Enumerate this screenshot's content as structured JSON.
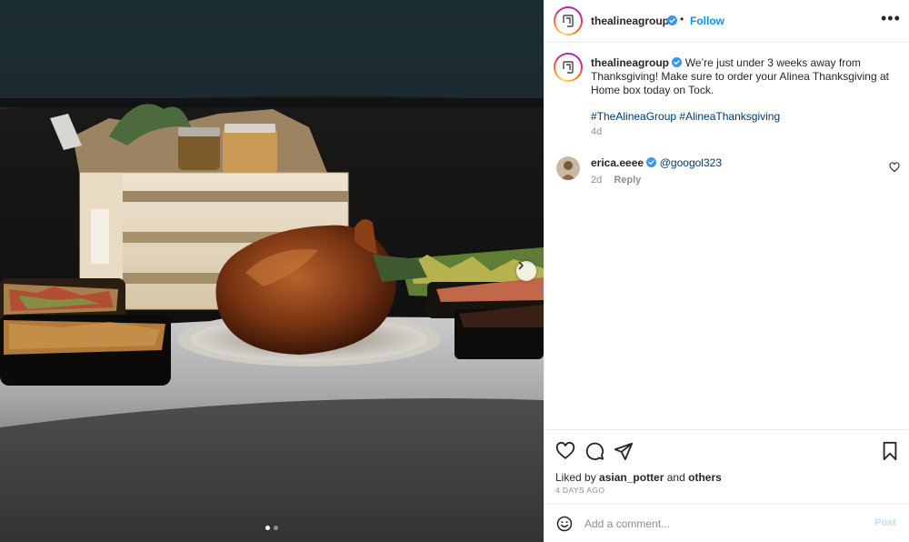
{
  "post": {
    "author": "thealineagroup",
    "follow_label": "Follow",
    "bullet": "•",
    "more_label": "•••",
    "caption_text": "We’re just under 3 weeks away from Thanksgiving! Make sure to order your Alinea Thanksgiving at Home box today on Tock.",
    "caption_tags": "#TheAlineaGroup #AlineaThanksgiving",
    "caption_age": "4d"
  },
  "comments": [
    {
      "user": "erica.eeee",
      "text": "@googol323",
      "age": "2d",
      "reply_label": "Reply"
    }
  ],
  "engagement": {
    "liked_by_prefix": "Liked by",
    "liked_by_user": "asian_potter",
    "liked_by_and": "and",
    "liked_by_others": "others",
    "date": "4 DAYS AGO"
  },
  "composer": {
    "placeholder": "Add a comment...",
    "post_label": "Post"
  },
  "carousel": {
    "slides": 2,
    "current": 1
  },
  "colors": {
    "accent": "#0095f6",
    "verified": "#3897f0",
    "link": "#00376b",
    "muted": "#8e8e8e"
  },
  "icons": [
    "more-icon",
    "verified-icon",
    "heart-icon",
    "comment-icon",
    "share-icon",
    "bookmark-icon",
    "emoji-icon",
    "chevron-right-icon"
  ]
}
